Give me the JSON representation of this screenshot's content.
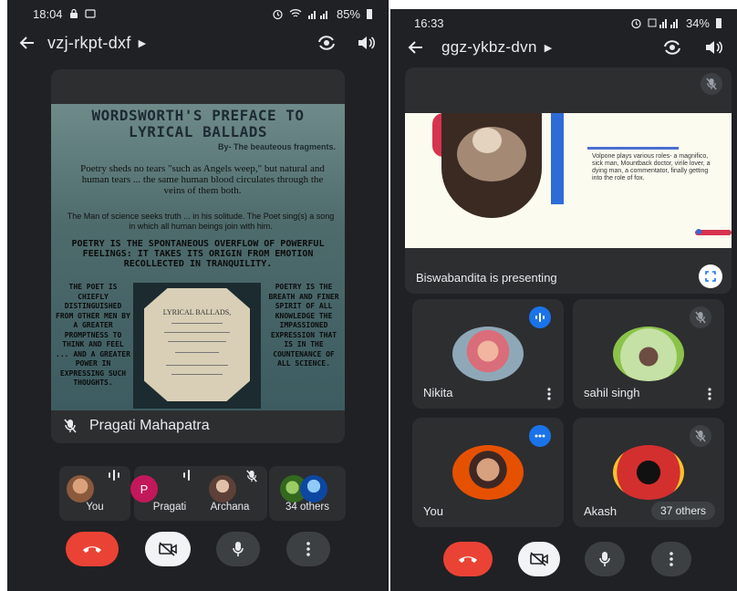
{
  "left": {
    "status": {
      "time": "18:04",
      "battery": "85%"
    },
    "meeting_code": "vzj-rkpt-dxf",
    "slide": {
      "title": "WORDSWORTH'S PREFACE TO LYRICAL BALLADS",
      "byline": "By- The beauteous fragments.",
      "para1": "Poetry sheds no tears \"such as Angels weep,\" but natural and human tears ... the same human blood circulates through the veins of them both.",
      "para2": "The Man of science seeks truth ... in his solitude. The Poet sing(s) a song in which all human beings join with him.",
      "quote": "POETRY IS THE SPONTANEOUS OVERFLOW OF POWERFUL FEELINGS: IT TAKES ITS ORIGIN FROM EMOTION RECOLLECTED IN TRANQUILITY.",
      "col_left": "THE POET IS CHIEFLY DISTINGUISHED FROM OTHER MEN BY A GREATER PROMPTNESS TO THINK AND FEEL ... AND A GREATER POWER IN EXPRESSING SUCH THOUGHTS.",
      "col_right": "POETRY IS THE BREATH AND FINER SPIRIT OF ALL KNOWLEDGE THE IMPASSIONED EXPRESSION THAT IS IN THE COUNTENANCE OF ALL SCIENCE.",
      "book_title": "LYRICAL BALLADS,"
    },
    "tile_name": "Pragati Mahapatra",
    "participants": [
      {
        "label": "You"
      },
      {
        "label": "Pragati",
        "initial": "P"
      },
      {
        "label": "Archana"
      },
      {
        "label": "34 others"
      }
    ]
  },
  "right": {
    "status": {
      "time": "16:33",
      "battery": "34%"
    },
    "meeting_code": "ggz-ykbz-dvn",
    "slide_text": "Volpone plays various roles- a magnifico, sick man, Mountback doctor, virile lover, a dying man, a commentator, finally getting into the role of fox.",
    "presenting": "Biswabandita is presenting",
    "tiles": [
      {
        "name": "Nikita"
      },
      {
        "name": "sahil singh"
      },
      {
        "name": "You"
      },
      {
        "name": "Akash"
      }
    ],
    "others": "37 others"
  },
  "colors": {
    "bg": "#202124",
    "tile": "#2d2e30",
    "end_call": "#ea4335",
    "speaking": "#1a73e8"
  }
}
